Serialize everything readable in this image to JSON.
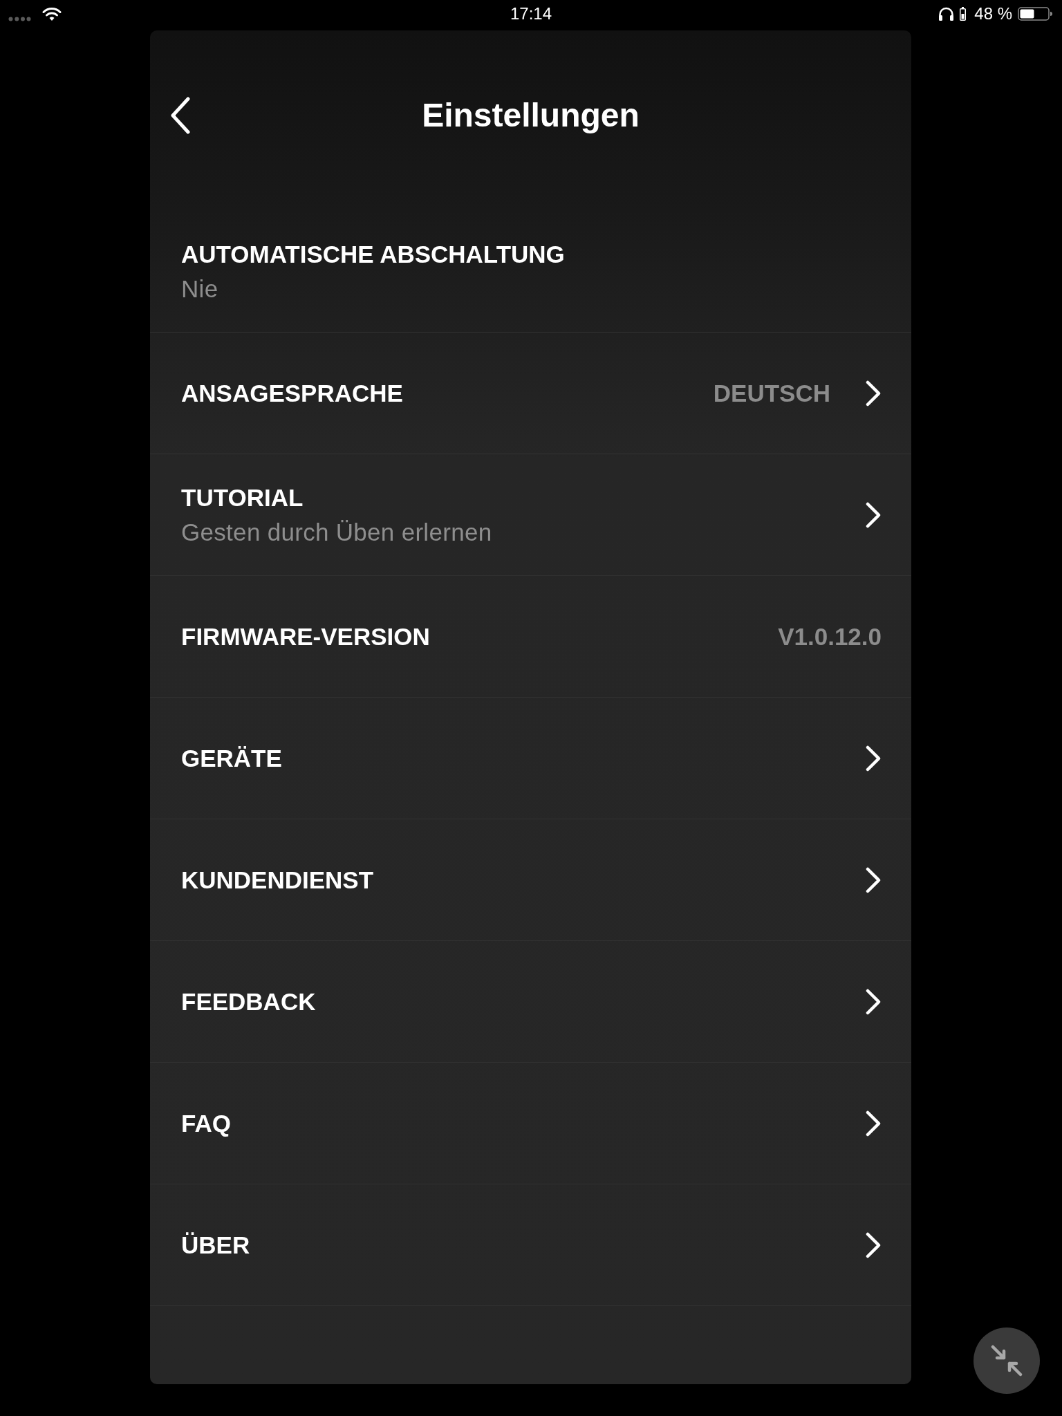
{
  "status_bar": {
    "time": "17:14",
    "battery_percent": "48 %"
  },
  "header": {
    "title": "Einstellungen"
  },
  "settings": [
    {
      "kind": "static",
      "label": "AUTOMATISCHE ABSCHALTUNG",
      "subtitle": "Nie"
    },
    {
      "kind": "link",
      "label": "ANSAGESPRACHE",
      "value": "DEUTSCH"
    },
    {
      "kind": "link",
      "label": "TUTORIAL",
      "subtitle": "Gesten durch Üben erlernen"
    },
    {
      "kind": "static",
      "label": "FIRMWARE-VERSION",
      "value": "V1.0.12.0"
    },
    {
      "kind": "link",
      "label": "GERÄTE"
    },
    {
      "kind": "link",
      "label": "KUNDENDIENST"
    },
    {
      "kind": "link",
      "label": "FEEDBACK"
    },
    {
      "kind": "link",
      "label": "FAQ"
    },
    {
      "kind": "link",
      "label": "ÜBER"
    }
  ]
}
